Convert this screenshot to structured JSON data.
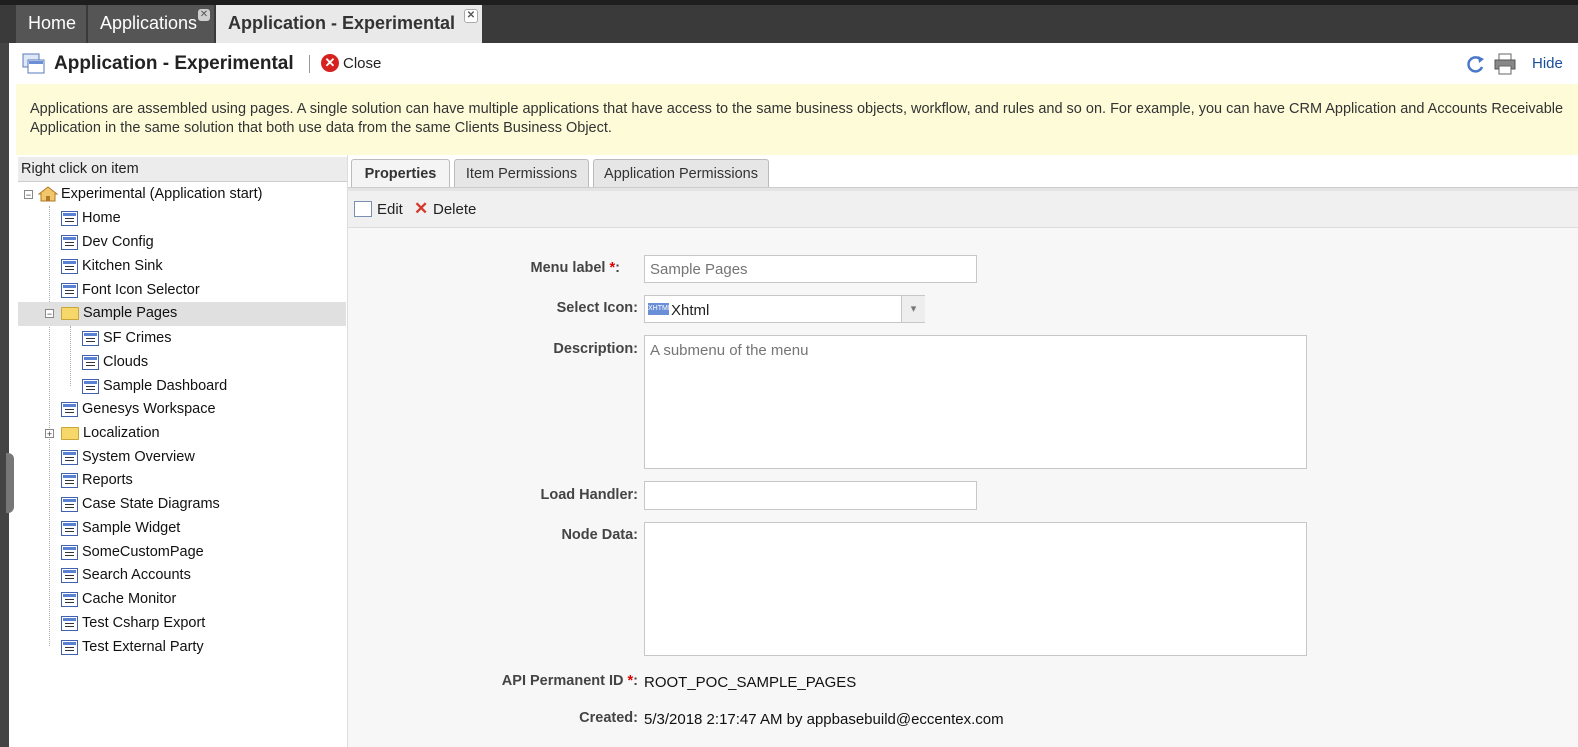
{
  "top_tabs": [
    {
      "label": "Home"
    },
    {
      "label": "Applications",
      "close": "✕"
    },
    {
      "label": "Application - Experimental",
      "close": "✕"
    }
  ],
  "header": {
    "title": "Application - Experimental",
    "close_label": "Close",
    "hide_label": "Hide"
  },
  "info_text": "Applications are assembled using pages. A single solution can have multiple applications that have access to the same business objects, workflow, and rules and so on. For example, you can have CRM Application and Accounts Receivable Application in the same solution that both use data from the same Clients Business Object.",
  "tree": {
    "header": "Right click on item",
    "items": [
      {
        "label": "Experimental (Application start)"
      },
      {
        "label": "Home"
      },
      {
        "label": "Dev Config"
      },
      {
        "label": "Kitchen Sink"
      },
      {
        "label": "Font Icon Selector"
      },
      {
        "label": "Sample Pages"
      },
      {
        "label": "SF Crimes"
      },
      {
        "label": "Clouds"
      },
      {
        "label": "Sample Dashboard"
      },
      {
        "label": "Genesys Workspace"
      },
      {
        "label": "Localization"
      },
      {
        "label": "System Overview"
      },
      {
        "label": "Reports"
      },
      {
        "label": "Case State Diagrams"
      },
      {
        "label": "Sample Widget"
      },
      {
        "label": "SomeCustomPage"
      },
      {
        "label": "Search Accounts"
      },
      {
        "label": "Cache Monitor"
      },
      {
        "label": "Test Csharp Export"
      },
      {
        "label": "Test External Party"
      }
    ]
  },
  "right_tabs": [
    {
      "label": "Properties"
    },
    {
      "label": "Item Permissions"
    },
    {
      "label": "Application Permissions"
    }
  ],
  "toolbar": {
    "edit_label": "Edit",
    "delete_label": "Delete"
  },
  "form": {
    "menu_label": {
      "label": "Menu label",
      "placeholder": "Sample Pages"
    },
    "select_icon": {
      "label": "Select Icon:",
      "value": "Xhtml",
      "glyph": "XHTML"
    },
    "description": {
      "label": "Description:",
      "placeholder": "A submenu of the menu"
    },
    "load_handler": {
      "label": "Load Handler:"
    },
    "node_data": {
      "label": "Node Data:"
    },
    "api_id": {
      "label": "API Permanent ID",
      "value": "ROOT_POC_SAMPLE_PAGES"
    },
    "created": {
      "label": "Created:",
      "value": "5/3/2018 2:17:47 AM by appbasebuild@eccentex.com"
    }
  }
}
